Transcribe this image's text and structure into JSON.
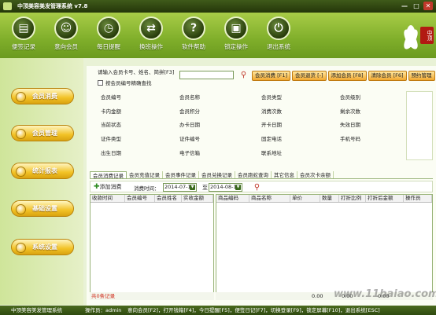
{
  "app": {
    "title": "中顶美容美发管理系统 v7.8"
  },
  "window": {
    "min": "—",
    "max": "□",
    "close": "✕"
  },
  "toolbar": {
    "items": [
      {
        "label": "便签记录",
        "icon": "document-icon"
      },
      {
        "label": "意向会员",
        "icon": "person-icon"
      },
      {
        "label": "每日提醒",
        "icon": "alarm-clock-icon"
      },
      {
        "label": "换班操作",
        "icon": "swap-arrows-icon"
      },
      {
        "label": "软件帮助",
        "icon": "help-icon"
      },
      {
        "label": "锁定操作",
        "icon": "lock-icon"
      },
      {
        "label": "退出系统",
        "icon": "power-icon"
      }
    ]
  },
  "brand": {
    "logo_text": "中顶"
  },
  "sidebar": {
    "items": [
      {
        "label": "会员消费"
      },
      {
        "label": "会员管理"
      },
      {
        "label": "统计报表"
      },
      {
        "label": "基础设置"
      },
      {
        "label": "系统设置"
      }
    ]
  },
  "search": {
    "label": "请输入会员卡号、姓名、简拼[F3]",
    "value": "",
    "checkbox_label": "按会员编号精确查找"
  },
  "actions": [
    "会员消费 [F1]",
    "会员退货 [-]",
    "添加会员 [F8]",
    "清除会员 [F6]",
    "预约管理",
    "会"
  ],
  "info_fields": [
    [
      "会员编号",
      "会员名称",
      "会员类型",
      "会员级别"
    ],
    [
      "卡内金额",
      "会员积分",
      "消费次数",
      "剩余次数"
    ],
    [
      "当前状态",
      "办卡日期",
      "开卡日期",
      "失效日期"
    ],
    [
      "证件类型",
      "证件编号",
      "固定电话",
      "手机号码"
    ],
    [
      "出生日期",
      "电子信箱",
      "联系地址",
      ""
    ]
  ],
  "tabs": [
    "会员消费记录",
    "会员充值记录",
    "会员事件记录",
    "会员兑换记录",
    "会员跑蛇查询",
    "其它信息",
    "会员次卡余额"
  ],
  "filter": {
    "add_label": "添加消费",
    "time_label": "消费时间：",
    "date_from": "2014-07-12",
    "to_label": "至",
    "date_to": "2014-08-12"
  },
  "left_table": {
    "columns": [
      "收款时间",
      "会员编号",
      "会员姓名",
      "实收金额"
    ],
    "footer": "共0条记录"
  },
  "right_table": {
    "columns": [
      "商品编码",
      "商品名称",
      "单价",
      "数量",
      "打折比例",
      "打折后金额",
      "操作员"
    ],
    "footer_values": [
      "0.00",
      "0.00",
      "0.00"
    ]
  },
  "status": {
    "items": [
      "中顶美容美发管理系统",
      "操作员：admin",
      "意向会员[F2]，打开钱箱[F4]，今日提醒[F5]，便签日记[F7]，切换登录[F9]，锁定屏幕[F10]，退出系统[ESC]"
    ]
  },
  "watermark": "www.11baiao.com"
}
